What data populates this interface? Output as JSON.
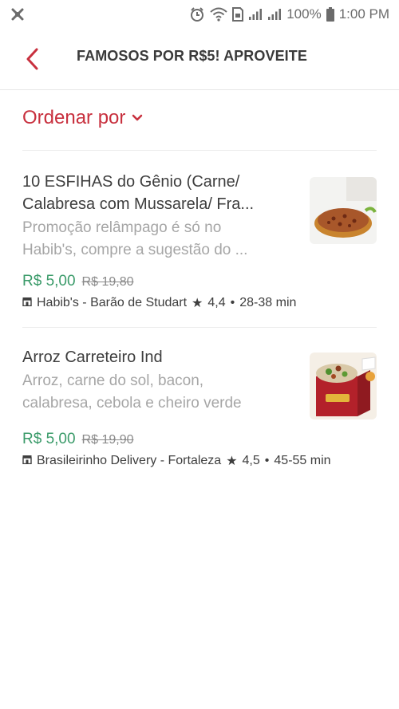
{
  "status_bar": {
    "battery": "100%",
    "time": "1:00 PM"
  },
  "header": {
    "title": "FAMOSOS POR R$5! APROVEITE"
  },
  "sort": {
    "label": "Ordenar por"
  },
  "items": [
    {
      "title": "10 ESFIHAS do Gênio (Carne/ Calabresa com Mussarela/ Fra...",
      "title_line1": "10 ESFIHAS do Gênio (Carne/",
      "title_line2": "Calabresa com Mussarela/ Fra...",
      "desc_line1": "Promoção relâmpago é só no",
      "desc_line2": "Habib's, compre a sugestão do ...",
      "price": "R$ 5,00",
      "old_price": "R$ 19,80",
      "store": "Habib's - Barão de Studart",
      "rating": "4,4",
      "time": "28-38 min"
    },
    {
      "title": "Arroz Carreteiro Ind",
      "desc_line1": "Arroz, carne do sol, bacon,",
      "desc_line2": "calabresa, cebola e cheiro verde",
      "price": "R$ 5,00",
      "old_price": "R$ 19,90",
      "store": "Brasileirinho Delivery - Fortaleza",
      "rating": "4,5",
      "time": "45-55 min"
    }
  ],
  "colors": {
    "accent": "#c8303e",
    "price_green": "#3b9b6a",
    "muted": "#a6a6a6"
  }
}
